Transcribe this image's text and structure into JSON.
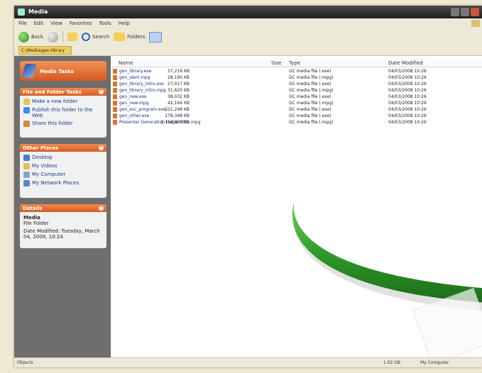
{
  "window": {
    "title": "Media"
  },
  "menu": [
    "File",
    "Edit",
    "View",
    "Favorites",
    "Tools",
    "Help"
  ],
  "toolbar": {
    "back": "Back",
    "search": "Search",
    "folders": "Folders"
  },
  "address": {
    "value": "C:\\Media\\gen-library"
  },
  "banner": {
    "title": "Media Tasks"
  },
  "panels": {
    "tasks": {
      "title": "File and Folder Tasks",
      "items": [
        "Make a new folder",
        "Publish this folder to the Web",
        "Share this folder"
      ]
    },
    "places": {
      "title": "Other Places",
      "items": [
        "Desktop",
        "My Videos",
        "My Computer",
        "My Network Places"
      ]
    },
    "details": {
      "title": "Details",
      "name": "Media",
      "kind": "File Folder",
      "modified": "Date Modified: Tuesday, March 04, 2008, 10:24"
    }
  },
  "columns": {
    "name": "Name",
    "size": "Size",
    "type": "Type",
    "date": "Date Modified"
  },
  "files": [
    {
      "name": "gen_library.exe",
      "size": "37,216 KB",
      "type": "GC media file (.exe)",
      "date": "04/03/2008 10:26"
    },
    {
      "name": "gen_alert.mpg",
      "size": "28,190 KB",
      "type": "GC media file (.mpg)",
      "date": "04/03/2008 10:26"
    },
    {
      "name": "gen_library_intro.exe",
      "size": "27,017 KB",
      "type": "GC media file (.exe)",
      "date": "04/03/2008 10:26"
    },
    {
      "name": "gen_library_intro.mpg",
      "size": "31,620 KB",
      "type": "GC media file (.mpg)",
      "date": "04/03/2008 10:26"
    },
    {
      "name": "gen_new.exe",
      "size": "38,032 KB",
      "type": "GC media file (.exe)",
      "date": "04/03/2008 10:26"
    },
    {
      "name": "gen_new.mpg",
      "size": "42,166 KB",
      "type": "GC media file (.mpg)",
      "date": "04/03/2008 10:26"
    },
    {
      "name": "gen_soc_program.exe",
      "size": "221,248 KB",
      "type": "GC media file (.exe)",
      "date": "04/03/2008 10:26"
    },
    {
      "name": "gen_other.exe",
      "size": "178,348 KB",
      "type": "GC media file (.exe)",
      "date": "04/03/2008 10:26"
    },
    {
      "name": "Presenter Generation Helper 002.mpg",
      "size": "1,114,808 KB",
      "type": "GC media file (.mpg)",
      "date": "04/03/2008 10:26"
    }
  ],
  "status": {
    "left": "Objects",
    "size": "1.02 GB",
    "zone": "My Computer"
  }
}
